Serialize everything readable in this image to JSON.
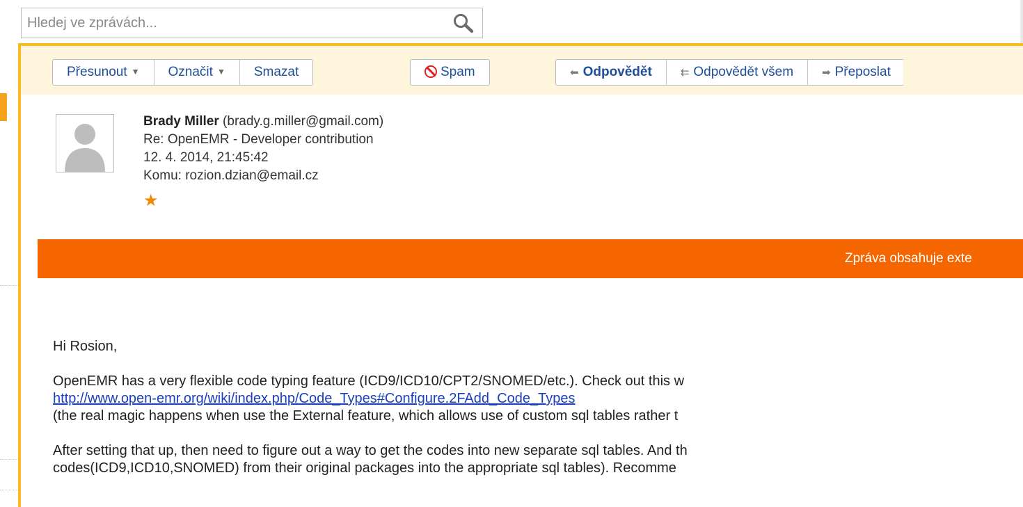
{
  "search": {
    "placeholder": "Hledej ve zprávách..."
  },
  "toolbar": {
    "move_label": "Přesunout",
    "mark_label": "Označit",
    "delete_label": "Smazat",
    "spam_label": "Spam",
    "reply_label": "Odpovědět",
    "reply_all_label": "Odpovědět všem",
    "forward_label": "Přeposlat"
  },
  "message": {
    "sender_name": "Brady Miller",
    "sender_email": "(brady.g.miller@gmail.com)",
    "subject": "Re: OpenEMR - Developer contribution",
    "date": "12. 4. 2014, 21:45:42",
    "to": "Komu: rozion.dzian@email.cz",
    "star": "★",
    "notice": "Zpráva obsahuje exte",
    "body": {
      "greeting": "Hi Rosion,",
      "p1_line1": "OpenEMR has a very flexible code typing feature (ICD9/ICD10/CPT2/SNOMED/etc.). Check out this w",
      "link": "http://www.open-emr.org/wiki/index.php/Code_Types#Configure.2FAdd_Code_Types",
      "p1_line3": "(the real magic happens when use the External feature, which allows use of custom sql tables rather t",
      "p2_line1": "After setting that up, then need to figure out a way to get the codes into new separate sql tables. And th",
      "p2_line2": "codes(ICD9,ICD10,SNOMED) from their original packages into the appropriate sql tables). Recomme"
    }
  },
  "colors": {
    "accent_orange": "#f56500",
    "panel_border": "#f9bb22",
    "toolbar_bg": "#fff5dd",
    "button_text": "#1f4f99",
    "link": "#1a3fbf",
    "star": "#f08a00"
  },
  "icons": [
    "search-icon",
    "caret-down-icon",
    "spam-icon",
    "reply-icon",
    "reply-all-icon",
    "forward-icon",
    "avatar-placeholder-icon",
    "star-icon"
  ]
}
